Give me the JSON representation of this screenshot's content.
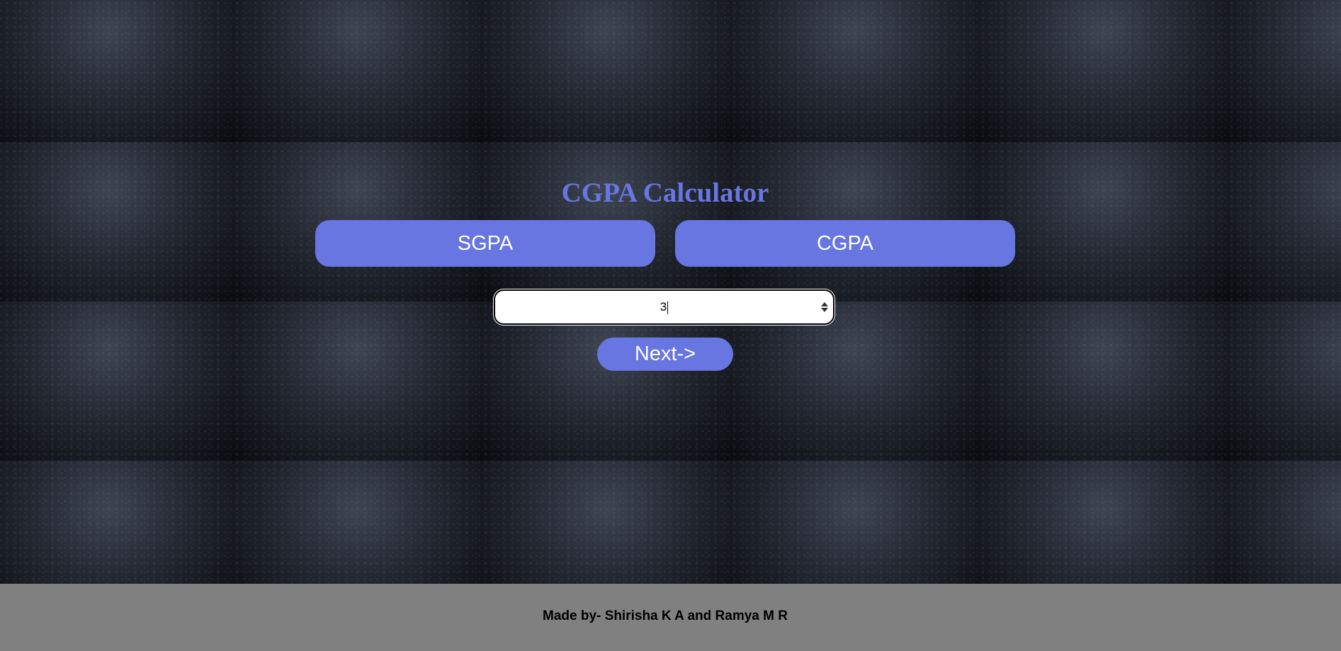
{
  "page": {
    "title": "CGPA Calculator"
  },
  "tabs": {
    "sgpa_label": "SGPA",
    "cgpa_label": "CGPA"
  },
  "semester_input": {
    "value": "3"
  },
  "next_button": {
    "label": "Next->"
  },
  "footer": {
    "text": "Made by- Shirisha K A and Ramya M R"
  },
  "colors": {
    "accent": "#6776e0",
    "footer_bg": "#808080",
    "background": "#1b1f28"
  }
}
